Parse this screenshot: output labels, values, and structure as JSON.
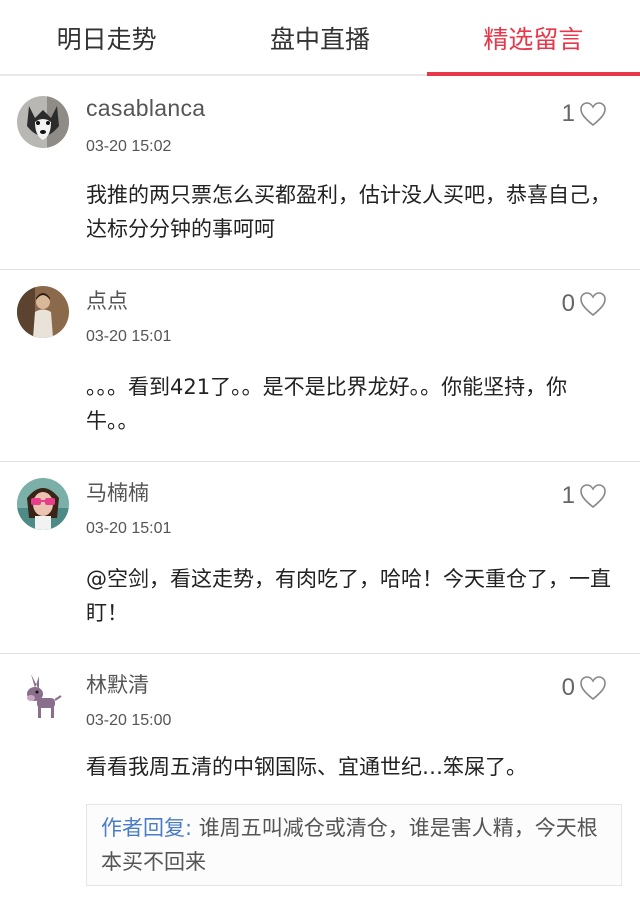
{
  "tabs": [
    {
      "label": "明日走势",
      "active": false
    },
    {
      "label": "盘中直播",
      "active": false
    },
    {
      "label": "精选留言",
      "active": true
    }
  ],
  "accent_color": "#e8374a",
  "comments": [
    {
      "username": "casablanca",
      "time": "03-20 15:02",
      "likes": "1",
      "text": "我推的两只票怎么买都盈利，估计没人买吧，恭喜自己，达标分分钟的事呵呵",
      "avatar_icon": "husky-dog-avatar"
    },
    {
      "username": "点点",
      "time": "03-20 15:01",
      "likes": "0",
      "text": "。。。看到421了。。是不是比界龙好。。你能坚持，你牛。。",
      "avatar_icon": "person-photo-avatar"
    },
    {
      "username": "马楠楠",
      "time": "03-20 15:01",
      "likes": "1",
      "text": "@空剑，看这走势，有肉吃了，哈哈！今天重仓了，一直盯！",
      "avatar_icon": "woman-glasses-avatar"
    },
    {
      "username": "林默清",
      "time": "03-20 15:00",
      "likes": "0",
      "text": "看看我周五清的中钢国际、宜通世纪…笨屎了。",
      "avatar_icon": "donkey-cartoon-avatar",
      "reply": {
        "label": "作者回复:",
        "text": " 谁周五叫减仓或清仓，谁是害人精，今天根本买不回来"
      }
    }
  ]
}
